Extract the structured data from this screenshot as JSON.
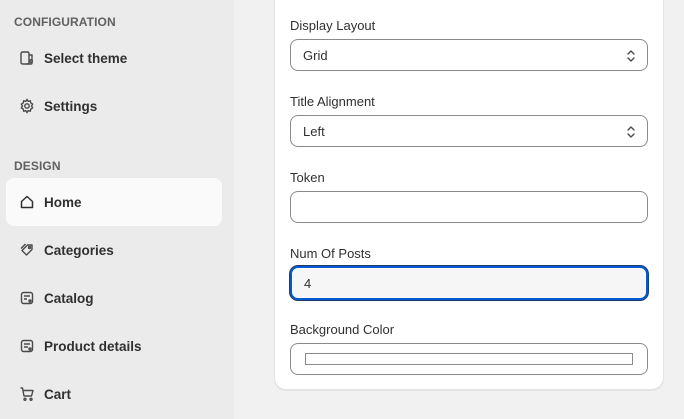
{
  "sidebar": {
    "sections": [
      {
        "title": "CONFIGURATION"
      },
      {
        "title": "DESIGN"
      }
    ],
    "items": [
      {
        "label": "Select theme",
        "icon": "theme-icon"
      },
      {
        "label": "Settings",
        "icon": "gear-icon"
      },
      {
        "label": "Home",
        "icon": "home-icon",
        "active": true
      },
      {
        "label": "Categories",
        "icon": "tag-icon"
      },
      {
        "label": "Catalog",
        "icon": "catalog-icon"
      },
      {
        "label": "Product details",
        "icon": "product-details-icon"
      },
      {
        "label": "Cart",
        "icon": "cart-icon"
      }
    ]
  },
  "form": {
    "display_layout": {
      "label": "Display Layout",
      "value": "Grid"
    },
    "title_alignment": {
      "label": "Title Alignment",
      "value": "Left"
    },
    "token": {
      "label": "Token",
      "value": ""
    },
    "num_of_posts": {
      "label": "Num Of Posts",
      "value": "4"
    },
    "background_color": {
      "label": "Background Color",
      "value": "#ffffff"
    }
  },
  "colors": {
    "sidebar_bg": "#ebebeb",
    "active_item_bg": "#fafafa",
    "focus_ring": "#005bd3"
  }
}
